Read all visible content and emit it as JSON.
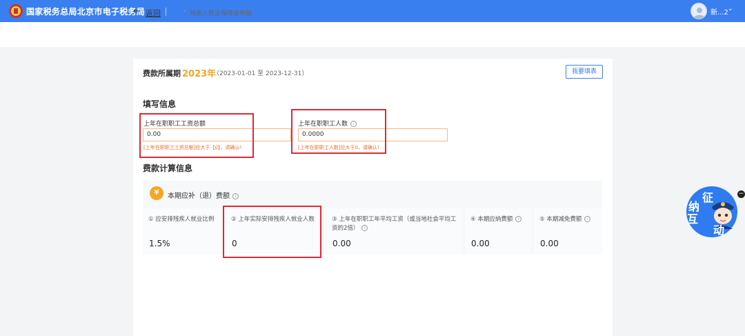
{
  "header": {
    "title": "国家税务总局北京市电子税务局",
    "username": "新...2"
  },
  "breadcrumb": {
    "back_label": "返回",
    "home": "首页",
    "current": "残疾人就业保障金申报"
  },
  "period": {
    "label": "费款所属期",
    "year": "2023年",
    "range": "（2023-01-01 至 2023-12-31）",
    "fill_button": "我要填表"
  },
  "fill_section": {
    "title": "填写信息",
    "field1": {
      "label": "上年在职职工工资总额",
      "value": "0.00",
      "error": "[上年在职职工工资总额]应大于【0】，请确认!"
    },
    "field2": {
      "label": "上年在职职工人数",
      "value": "0.0000",
      "error": "[上年在职职工人数]应大于0，请确认!"
    }
  },
  "calc_section": {
    "title": "费款计算信息",
    "panel_title": "本期应补（退）费额",
    "cells": [
      {
        "label": "① 应安排残疾人就业比例",
        "value": "1.5%"
      },
      {
        "label": "② 上年实际安排残疾人就业人数",
        "value": "0"
      },
      {
        "label": "③ 上年在职职工年平均工资（或当地社会平均工资的2倍）",
        "value": "0.00"
      },
      {
        "label": "④ 本期应纳费额",
        "value": "0.00"
      },
      {
        "label": "⑤ 本期减免费额",
        "value": "0.00"
      }
    ]
  },
  "assistant": {
    "chars": [
      "征",
      "纳",
      "互",
      "动"
    ]
  },
  "colors": {
    "primary": "#3a7ff0",
    "accent": "#f5a623",
    "error": "#ef6d26",
    "highlight": "#e2282f"
  }
}
